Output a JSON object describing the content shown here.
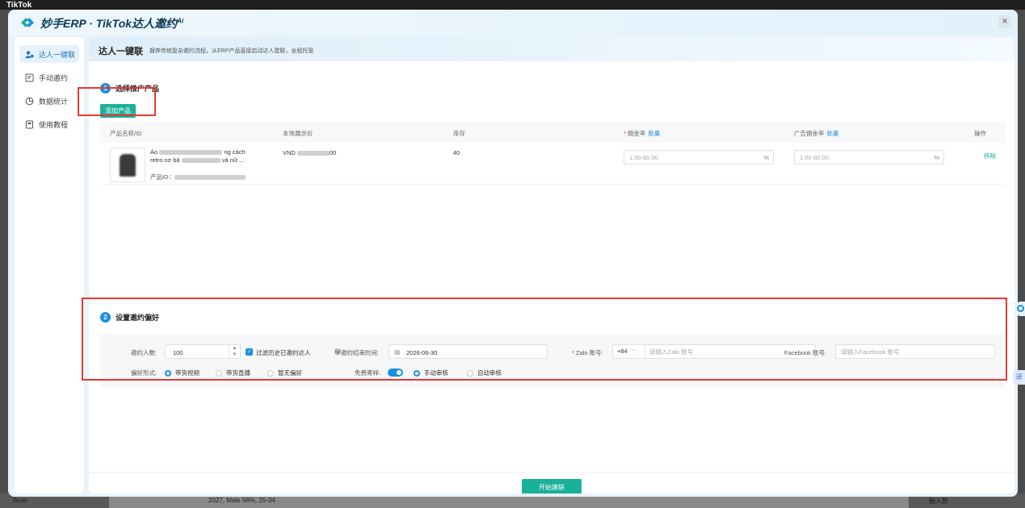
{
  "background": {
    "app_logo": "TikTok",
    "footer_left": "Bcas",
    "footer_mid": "2027, Male 58%, 25-34",
    "footer_right": "融入数"
  },
  "header": {
    "title": "妙手ERP · TikTok达人邀约",
    "title_sup": "Ai",
    "close_label": "×"
  },
  "sidebar": {
    "items": [
      {
        "label": "达人一键联",
        "icon": "user-link-icon",
        "active": true
      },
      {
        "label": "手动邀约",
        "icon": "manual-invite-icon",
        "active": false
      },
      {
        "label": "数据统计",
        "icon": "pie-chart-icon",
        "active": false
      },
      {
        "label": "使用教程",
        "icon": "tutorial-icon",
        "active": false
      }
    ]
  },
  "main": {
    "title": "达人一键联",
    "subtitle": "摒弃传统复杂邀约流程，从ERP产品直接启动达人建联，全程托管",
    "step1": {
      "num": "1",
      "label": "选择推广产品"
    },
    "add_product": "添加产品",
    "table": {
      "headers": {
        "name": "产品名称/ID",
        "price": "本地展示价",
        "stock": "库存",
        "commission": "佣金率",
        "commission_batch": "批量",
        "ad_commission": "广告佣金率",
        "ad_batch": "批量",
        "action": "操作"
      },
      "row": {
        "name_l1a": "Áo",
        "name_l1b": "ng cách",
        "name_l2a": "retro cơ bả",
        "name_l2b": "và nữ ...",
        "id_label": "产品ID：",
        "price_prefix": "VND",
        "price_suffix": "00",
        "stock": "40",
        "rate_placeholder": "1.00-80.00",
        "ad_rate_placeholder": "1.00-80.00",
        "pct": "%",
        "remove": "移除"
      }
    },
    "step2": {
      "num": "2",
      "label": "设置邀约偏好"
    },
    "prefs": {
      "invite_count_label": "邀约人数:",
      "invite_count_value": "100",
      "filter_label": "过滤历史已邀约达人",
      "end_time_label": "邀约结束时间:",
      "end_time_value": "2026-06-30",
      "zalo_label": "Zalo 账号:",
      "zalo_code": "+84",
      "zalo_placeholder": "请输入Zalo 账号",
      "facebook_label": "Facebook 账号:",
      "facebook_placeholder": "请输入Facebook 账号",
      "pref_form_label": "偏好形式:",
      "pref_options": [
        "带货视频",
        "带货直播",
        "暂无偏好"
      ],
      "free_sample_label": "免费寄样:",
      "review_options": [
        "手动审核",
        "自动审核"
      ]
    },
    "start_button": "开始建联"
  },
  "colors": {
    "accent_teal": "#1ab09a",
    "accent_blue": "#1a8fe0",
    "highlight_red": "#e53935"
  }
}
